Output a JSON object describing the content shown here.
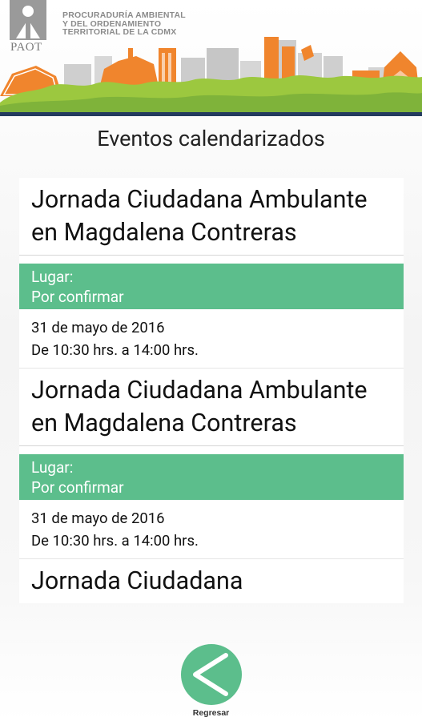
{
  "header": {
    "logo_text": "PAOT",
    "org_lines": [
      "PROCURADURÍA AMBIENTAL",
      "Y DEL ORDENAMIENTO",
      "TERRITORIAL DE LA CDMX"
    ],
    "colors": {
      "orange": "#f0852d",
      "green": "#9cc83f",
      "navy": "#233a5e",
      "gray": "#c9c9c9"
    }
  },
  "page": {
    "title": "Eventos calendarizados"
  },
  "events": [
    {
      "title": "Jornada Ciudadana Ambulante en Magdalena Contreras",
      "place_label": "Lugar:",
      "place_value": "Por confirmar",
      "date": "31 de mayo de 2016",
      "time": "De 10:30 hrs. a 14:00 hrs."
    },
    {
      "title": "Jornada Ciudadana Ambulante en Magdalena Contreras",
      "place_label": "Lugar:",
      "place_value": "Por confirmar",
      "date": "31 de mayo de 2016",
      "time": "De 10:30 hrs. a 14:00 hrs."
    },
    {
      "title": "Jornada Ciudadana",
      "place_label": "",
      "place_value": "",
      "date": "",
      "time": ""
    }
  ],
  "back_button": {
    "label": "Regresar",
    "icon": "chevron-left-icon",
    "color": "#5cbe8c"
  }
}
